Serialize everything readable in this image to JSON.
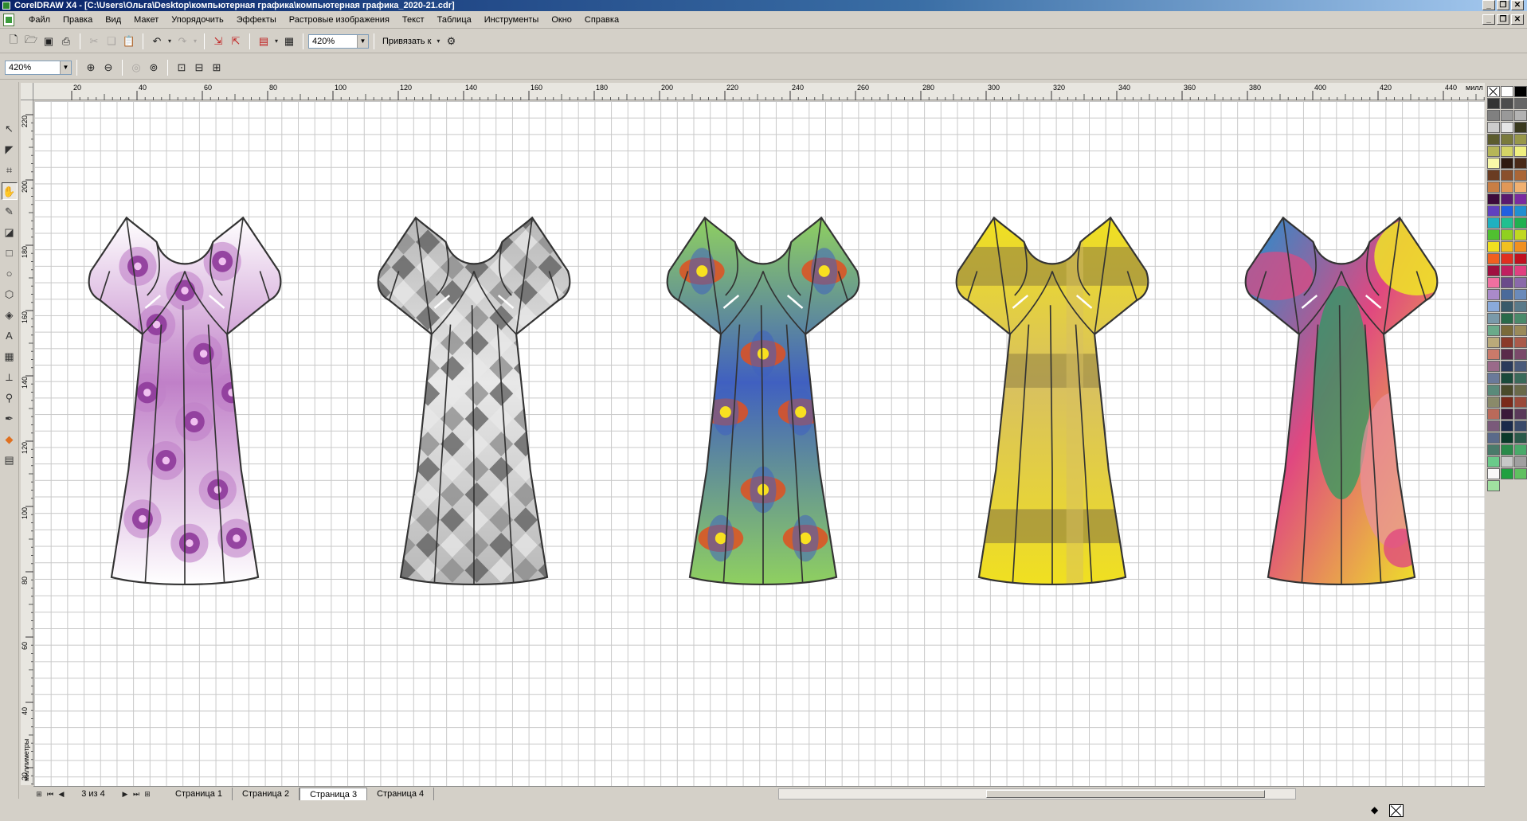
{
  "window": {
    "title": "CorelDRAW X4 - [C:\\Users\\Ольга\\Desktop\\компьютерная графика\\компьютерная графика_2020-21.cdr]",
    "min": "_",
    "restore": "❐",
    "close": "✕"
  },
  "menu": [
    "Файл",
    "Правка",
    "Вид",
    "Макет",
    "Упорядочить",
    "Эффекты",
    "Растровые изображения",
    "Текст",
    "Таблица",
    "Инструменты",
    "Окно",
    "Справка"
  ],
  "toolbar": {
    "zoom_value": "420%",
    "snap_label": "Привязать к",
    "zoom_value_2": "420%"
  },
  "ruler": {
    "unit": "милл",
    "h_labels": [
      "20",
      "40",
      "60",
      "80",
      "100",
      "120",
      "140",
      "160",
      "180",
      "200",
      "220",
      "240",
      "260",
      "280",
      "300",
      "320",
      "340",
      "360",
      "380",
      "400",
      "420",
      "440"
    ],
    "v_labels": [
      "220",
      "200",
      "180",
      "160",
      "140",
      "120",
      "100",
      "80",
      "60",
      "40",
      "20"
    ],
    "v_unit": "миллиметры"
  },
  "pages": {
    "counter": "3 из 4",
    "tabs": [
      "Страница 1",
      "Страница 2",
      "Страница 3",
      "Страница 4"
    ],
    "active": 2
  },
  "dresses": [
    {
      "name": "purple-floral",
      "base": "#ffffff",
      "accent": "#8e3a9a",
      "accent2": "#c080c8"
    },
    {
      "name": "grey-diamond",
      "base": "#b8b8b8",
      "accent": "#707070",
      "accent2": "#e8e8e8"
    },
    {
      "name": "green-fractal",
      "base": "#8fd060",
      "accent": "#e05020",
      "accent2": "#4060c0"
    },
    {
      "name": "yellow-gradient",
      "base": "#f0e020",
      "accent": "#8a7a40",
      "accent2": "#d8c060"
    },
    {
      "name": "multicolor-gradient",
      "base": "#2090d0",
      "accent": "#f0f020",
      "accent2": "#e04880"
    }
  ],
  "palette": [
    "#ffffff",
    "#000000",
    "#333333",
    "#4d4d4d",
    "#666666",
    "#808080",
    "#999999",
    "#b3b3b3",
    "#cccccc",
    "#e6e6e6",
    "#3a3a1e",
    "#5c5c2e",
    "#7a7a3c",
    "#98984a",
    "#b6b658",
    "#d4d466",
    "#f0f080",
    "#f8f8a8",
    "#2e1a10",
    "#4a2a18",
    "#6a3c22",
    "#8a502c",
    "#aa6636",
    "#c87e44",
    "#e09858",
    "#f0b070",
    "#3c0a3c",
    "#5a1a6e",
    "#7a2aa0",
    "#6040c0",
    "#2060e0",
    "#2090d0",
    "#20b0c0",
    "#20c090",
    "#20b050",
    "#50c030",
    "#90d020",
    "#c0d820",
    "#f0e020",
    "#f0c020",
    "#f09020",
    "#f06020",
    "#e03020",
    "#c01020",
    "#a01040",
    "#c02060",
    "#e04080",
    "#f070a0",
    "#6a4a8a",
    "#8a6aaa",
    "#aa8aca",
    "#4a6a9a",
    "#6a8aba",
    "#8aaada",
    "#3a5a6a",
    "#5a7a8a",
    "#7a9aaa",
    "#2a6a4a",
    "#4a8a6a",
    "#6aaa8a",
    "#7a6a3a",
    "#9a8a5a",
    "#baaa7a",
    "#8a3a2a",
    "#aa5a4a",
    "#ca7a6a",
    "#5a2a4a",
    "#7a4a6a",
    "#9a6a8a",
    "#2a3a5a",
    "#4a5a7a",
    "#6a7a9a",
    "#1a4a3a",
    "#3a6a5a",
    "#5a8a7a",
    "#4a4a2a",
    "#6a6a4a",
    "#8a8a6a",
    "#7a2a1a",
    "#9a4a3a",
    "#ba6a5a",
    "#3a1a3a",
    "#5a3a5a",
    "#7a5a7a",
    "#1a2a4a",
    "#3a4a6a",
    "#5a6a8a",
    "#0a3a2a",
    "#2a5a4a",
    "#4a7a6a",
    "#2a8a4a",
    "#4aaa6a",
    "#6aca8a",
    "#c8c8c8",
    "#a0a0a0",
    "#f8f8f8",
    "#20a040",
    "#60c060",
    "#a0e0a0"
  ]
}
